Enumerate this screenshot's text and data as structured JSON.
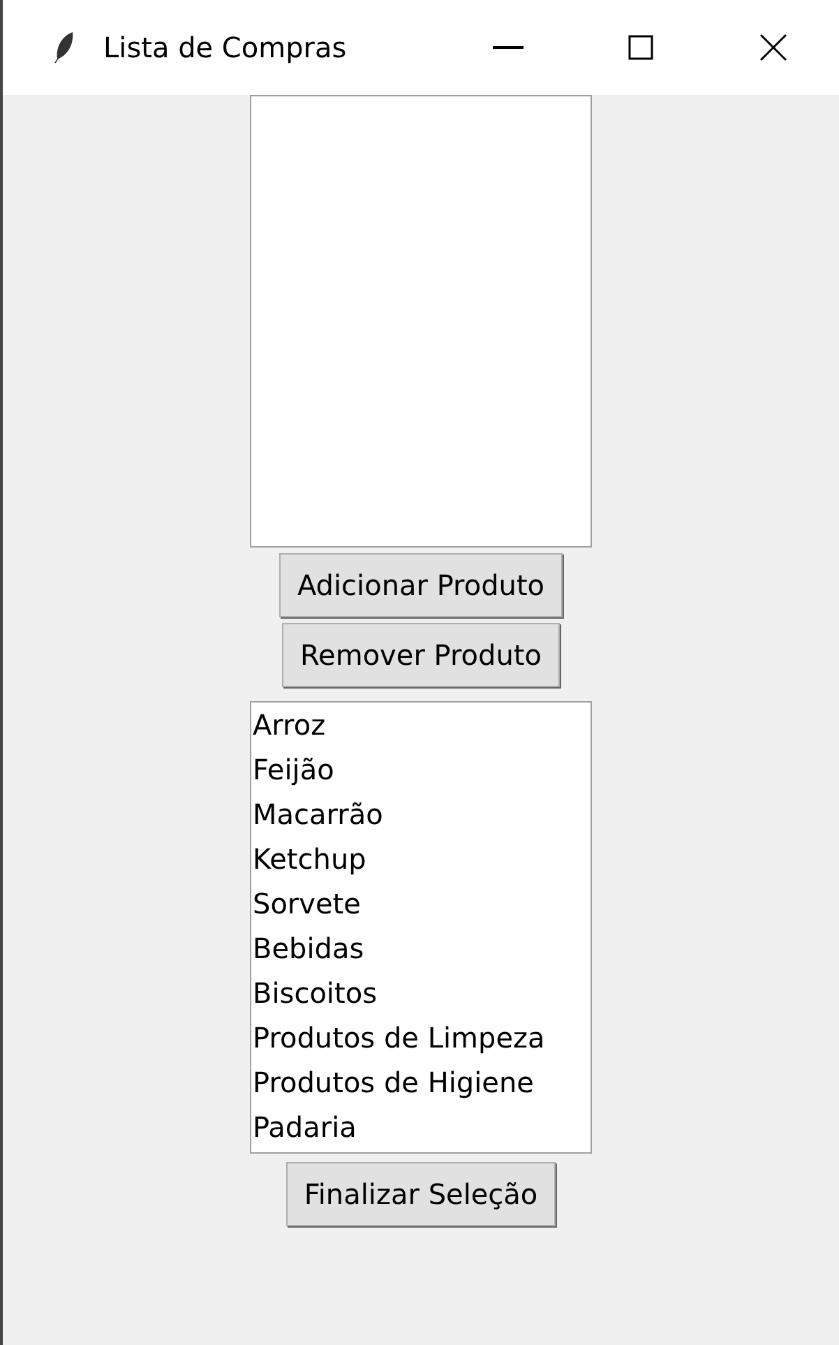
{
  "window": {
    "title": "Lista de Compras"
  },
  "buttons_top": [
    "Adicionar Produto",
    "Remover Produto"
  ],
  "products": [
    {
      "label": "Arroz"
    },
    {
      "label": "Feijão"
    },
    {
      "label": "Macarrão"
    },
    {
      "label": "Ketchup"
    },
    {
      "label": "Sorvete"
    },
    {
      "label": "Bebidas"
    },
    {
      "label": "Biscoitos"
    },
    {
      "label": "Produtos de Limpeza"
    },
    {
      "label": "Produtos de Higiene"
    },
    {
      "label": "Padaria"
    }
  ],
  "finish_button": "Finalizar Seleção"
}
